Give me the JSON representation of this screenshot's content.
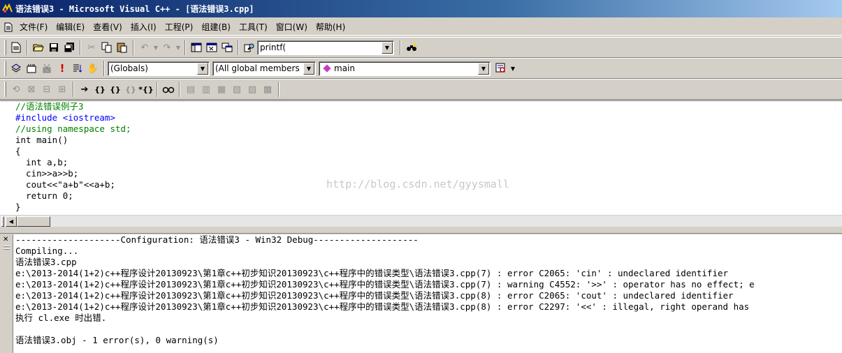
{
  "window": {
    "title": "语法错误3 - Microsoft Visual C++ - [语法错误3.cpp]"
  },
  "menu": [
    "文件(F)",
    "编辑(E)",
    "查看(V)",
    "插入(I)",
    "工程(P)",
    "组建(B)",
    "工具(T)",
    "窗口(W)",
    "帮助(H)"
  ],
  "toolbar1": {
    "find_value": "printf("
  },
  "toolbar2": {
    "scope_value": "(Globals)",
    "members_value": "(All global members",
    "function_value": "main"
  },
  "editor": {
    "lines": [
      "//语法错误例子3",
      "#include <iostream>",
      "//using namespace std;",
      "int main()",
      "{",
      "  int a,b;",
      "  cin>>a>>b;",
      "  cout<<\"a+b\"<<a+b;",
      "  return 0;",
      "}"
    ],
    "watermark": "http://blog.csdn.net/gyysmall"
  },
  "output": {
    "lines": [
      "--------------------Configuration: 语法错误3 - Win32 Debug--------------------",
      "Compiling...",
      "语法错误3.cpp",
      "e:\\2013-2014(1+2)c++程序设计20130923\\第1章c++初步知识20130923\\c++程序中的错误类型\\语法错误3.cpp(7) : error C2065: 'cin' : undeclared identifier",
      "e:\\2013-2014(1+2)c++程序设计20130923\\第1章c++初步知识20130923\\c++程序中的错误类型\\语法错误3.cpp(7) : warning C4552: '>>' : operator has no effect; e",
      "e:\\2013-2014(1+2)c++程序设计20130923\\第1章c++初步知识20130923\\c++程序中的错误类型\\语法错误3.cpp(8) : error C2065: 'cout' : undeclared identifier",
      "e:\\2013-2014(1+2)c++程序设计20130923\\第1章c++初步知识20130923\\c++程序中的错误类型\\语法错误3.cpp(8) : error C2297: '<<' : illegal, right operand has",
      "执行 cl.exe 时出错.",
      "",
      "语法错误3.obj - 1 error(s), 0 warning(s)"
    ]
  }
}
